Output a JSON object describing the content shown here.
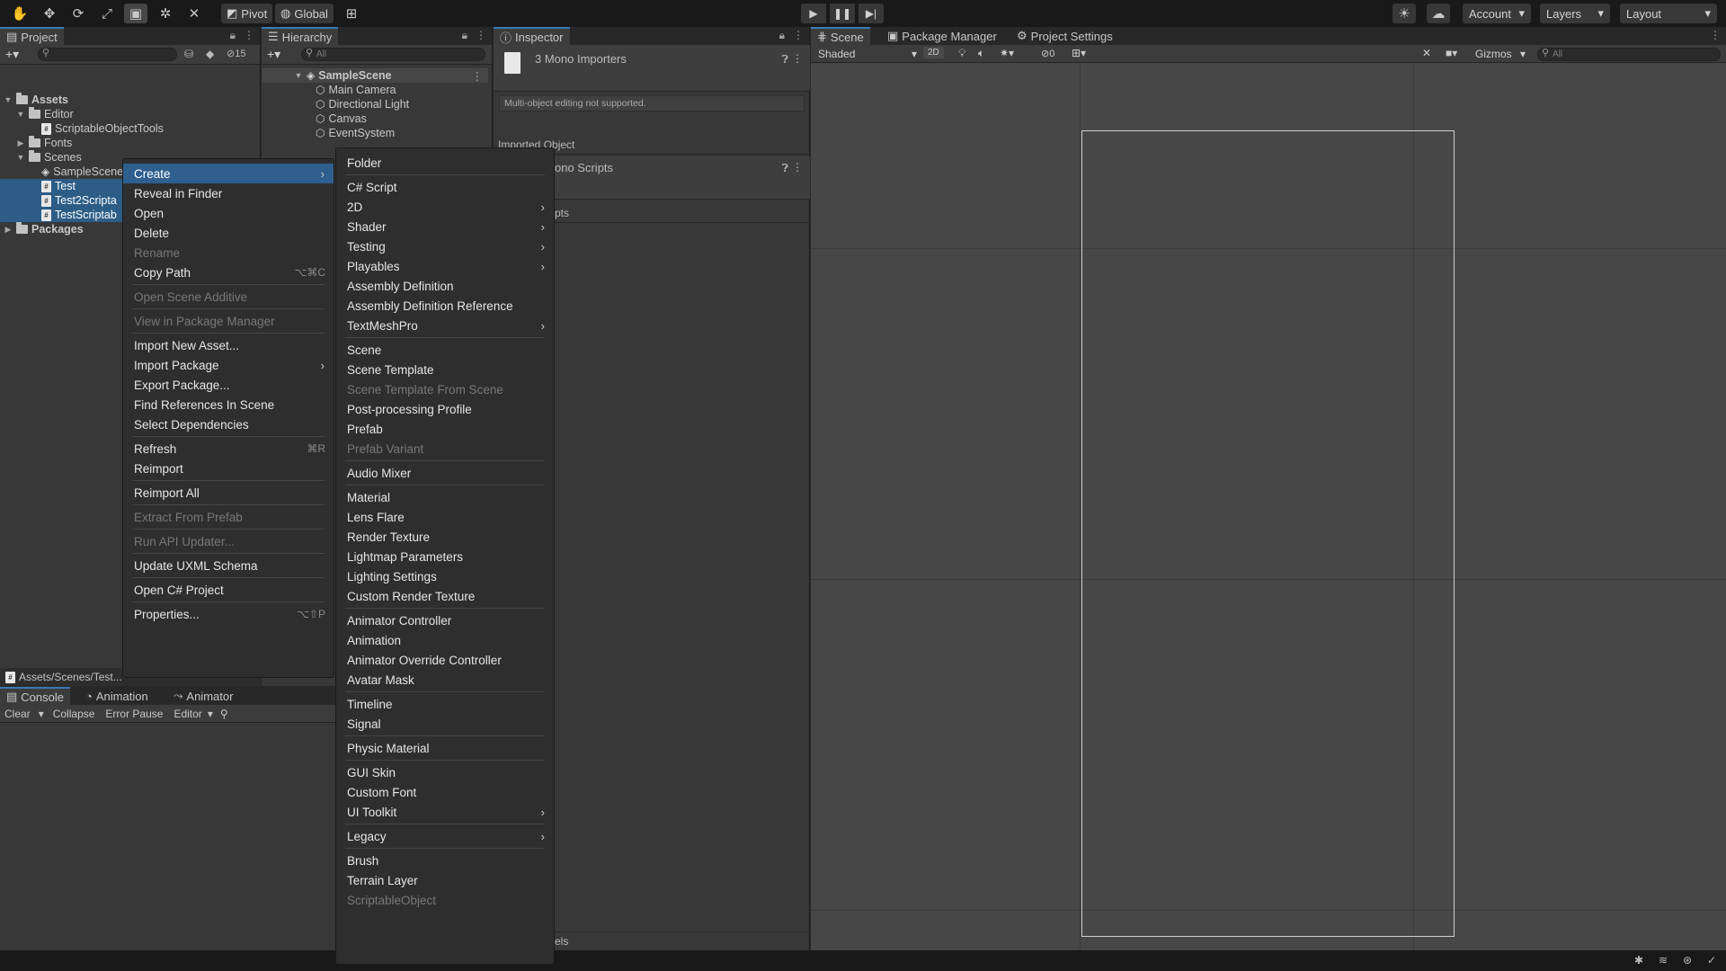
{
  "toolbar": {
    "pivot_label": "Pivot",
    "global_label": "Global",
    "account_label": "Account",
    "layers_label": "Layers",
    "layout_label": "Layout"
  },
  "project": {
    "tab_label": "Project",
    "hidden_count": "15",
    "tree": [
      {
        "label": "Assets",
        "type": "folder",
        "expanded": true
      },
      {
        "label": "Editor",
        "type": "folder",
        "expanded": true
      },
      {
        "label": "ScriptableObjectTools",
        "type": "script"
      },
      {
        "label": "Fonts",
        "type": "folder",
        "expanded": false
      },
      {
        "label": "Scenes",
        "type": "folder",
        "expanded": true
      },
      {
        "label": "SampleScene",
        "type": "scene"
      },
      {
        "label": "Test",
        "type": "script",
        "selected": true
      },
      {
        "label": "Test2Scripta",
        "type": "script",
        "selected": true
      },
      {
        "label": "TestScriptab",
        "type": "script",
        "selected": true
      },
      {
        "label": "Packages",
        "type": "folder",
        "expanded": false
      }
    ],
    "path_label": "Assets/Scenes/Test..."
  },
  "hierarchy": {
    "tab_label": "Hierarchy",
    "search_placeholder": "All",
    "scene_name": "SampleScene",
    "objects": [
      "Main Camera",
      "Directional Light",
      "Canvas",
      "EventSystem"
    ]
  },
  "inspector": {
    "tab_label": "Inspector",
    "title": "3 Mono Importers",
    "message": "Multi-object editing not supported.",
    "imported_object_label": "Imported Object",
    "section_title": "ono Scripts",
    "sub_label": "pts",
    "footer_label": "els"
  },
  "console": {
    "tabs": [
      "Console",
      "Animation",
      "Animator"
    ],
    "clear_label": "Clear",
    "collapse_label": "Collapse",
    "error_pause_label": "Error Pause",
    "editor_label": "Editor"
  },
  "scene": {
    "tabs": [
      "Scene",
      "Package Manager",
      "Project Settings"
    ],
    "shading_mode": "Shaded",
    "mode_2d": "2D",
    "hidden_count": "0",
    "gizmos_label": "Gizmos",
    "search_placeholder": "All"
  },
  "context_menu": {
    "items": [
      {
        "label": "Create",
        "submenu": true,
        "highlight": true
      },
      {
        "label": "Reveal in Finder"
      },
      {
        "label": "Open"
      },
      {
        "label": "Delete"
      },
      {
        "label": "Rename",
        "disabled": true
      },
      {
        "label": "Copy Path",
        "shortcut": "⌥⌘C"
      },
      {
        "sep": true
      },
      {
        "label": "Open Scene Additive",
        "disabled": true
      },
      {
        "sep": true
      },
      {
        "label": "View in Package Manager",
        "disabled": true
      },
      {
        "sep": true
      },
      {
        "label": "Import New Asset..."
      },
      {
        "label": "Import Package",
        "submenu": true
      },
      {
        "label": "Export Package..."
      },
      {
        "label": "Find References In Scene"
      },
      {
        "label": "Select Dependencies"
      },
      {
        "sep": true
      },
      {
        "label": "Refresh",
        "shortcut": "⌘R"
      },
      {
        "label": "Reimport"
      },
      {
        "sep": true
      },
      {
        "label": "Reimport All"
      },
      {
        "sep": true
      },
      {
        "label": "Extract From Prefab",
        "disabled": true
      },
      {
        "sep": true
      },
      {
        "label": "Run API Updater...",
        "disabled": true
      },
      {
        "sep": true
      },
      {
        "label": "Update UXML Schema"
      },
      {
        "sep": true
      },
      {
        "label": "Open C# Project"
      },
      {
        "sep": true
      },
      {
        "label": "Properties...",
        "shortcut": "⌥⇧P"
      }
    ]
  },
  "create_menu": {
    "items": [
      {
        "label": "Folder"
      },
      {
        "sep": true
      },
      {
        "label": "C# Script"
      },
      {
        "label": "2D",
        "submenu": true
      },
      {
        "label": "Shader",
        "submenu": true
      },
      {
        "label": "Testing",
        "submenu": true
      },
      {
        "label": "Playables",
        "submenu": true
      },
      {
        "label": "Assembly Definition"
      },
      {
        "label": "Assembly Definition Reference"
      },
      {
        "label": "TextMeshPro",
        "submenu": true
      },
      {
        "sep": true
      },
      {
        "label": "Scene"
      },
      {
        "label": "Scene Template"
      },
      {
        "label": "Scene Template From Scene",
        "disabled": true
      },
      {
        "label": "Post-processing Profile"
      },
      {
        "label": "Prefab"
      },
      {
        "label": "Prefab Variant",
        "disabled": true
      },
      {
        "sep": true
      },
      {
        "label": "Audio Mixer"
      },
      {
        "sep": true
      },
      {
        "label": "Material"
      },
      {
        "label": "Lens Flare"
      },
      {
        "label": "Render Texture"
      },
      {
        "label": "Lightmap Parameters"
      },
      {
        "label": "Lighting Settings"
      },
      {
        "label": "Custom Render Texture"
      },
      {
        "sep": true
      },
      {
        "label": "Animator Controller"
      },
      {
        "label": "Animation"
      },
      {
        "label": "Animator Override Controller"
      },
      {
        "label": "Avatar Mask"
      },
      {
        "sep": true
      },
      {
        "label": "Timeline"
      },
      {
        "label": "Signal"
      },
      {
        "sep": true
      },
      {
        "label": "Physic Material"
      },
      {
        "sep": true
      },
      {
        "label": "GUI Skin"
      },
      {
        "label": "Custom Font"
      },
      {
        "label": "UI Toolkit",
        "submenu": true
      },
      {
        "sep": true
      },
      {
        "label": "Legacy",
        "submenu": true
      },
      {
        "sep": true
      },
      {
        "label": "Brush"
      },
      {
        "label": "Terrain Layer"
      },
      {
        "label": "ScriptableObject",
        "disabled": true
      }
    ]
  },
  "colors": {
    "accent": "#2c5d87",
    "menu_bg": "#2e2e2e",
    "panel_bg": "#383838"
  }
}
